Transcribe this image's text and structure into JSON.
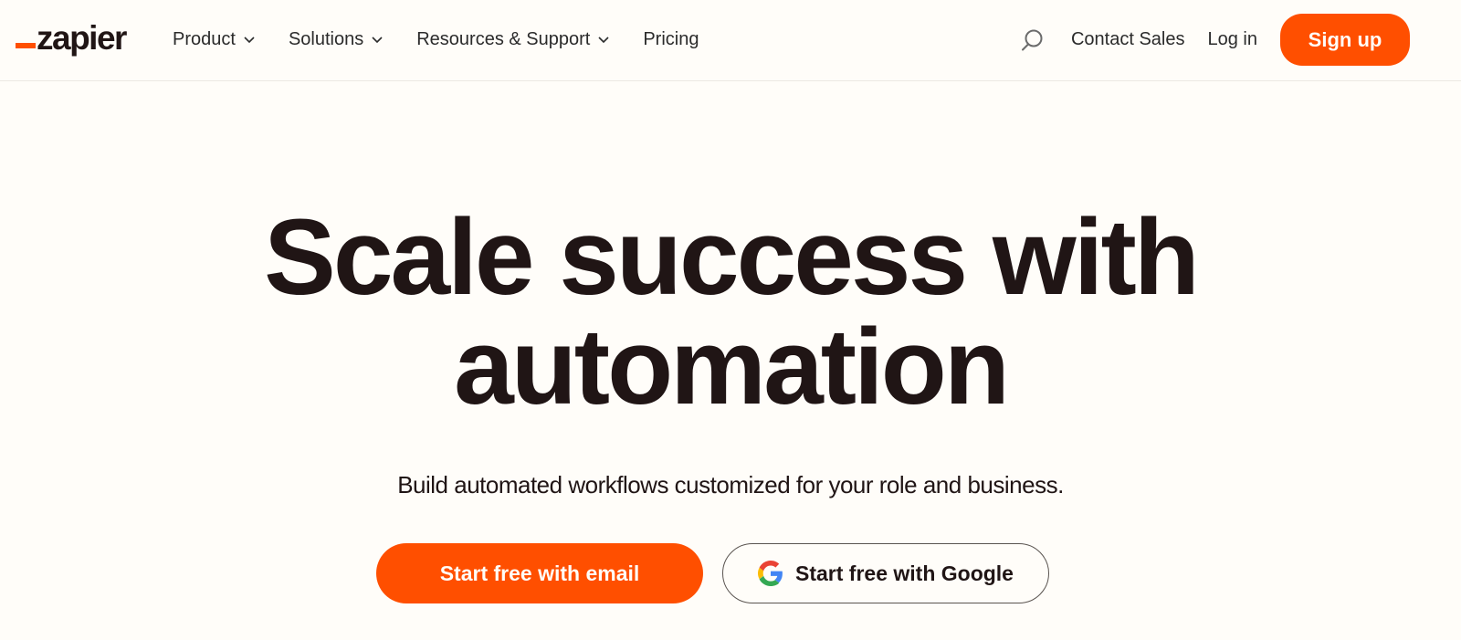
{
  "header": {
    "logo": "zapier",
    "nav": [
      {
        "label": "Product",
        "has_dropdown": true
      },
      {
        "label": "Solutions",
        "has_dropdown": true
      },
      {
        "label": "Resources & Support",
        "has_dropdown": true
      },
      {
        "label": "Pricing",
        "has_dropdown": false
      }
    ],
    "search_icon": "search-icon",
    "contact_sales": "Contact Sales",
    "log_in": "Log in",
    "sign_up": "Sign up"
  },
  "hero": {
    "title_line1": "Scale success with",
    "title_line2": "automation",
    "subtitle": "Build automated workflows customized for your role and business.",
    "cta_email": "Start free with email",
    "cta_google": "Start free with Google",
    "google_icon": "google-g-icon"
  },
  "colors": {
    "brand": "#ff4f00",
    "background": "#fffdf9",
    "text": "#201515"
  }
}
